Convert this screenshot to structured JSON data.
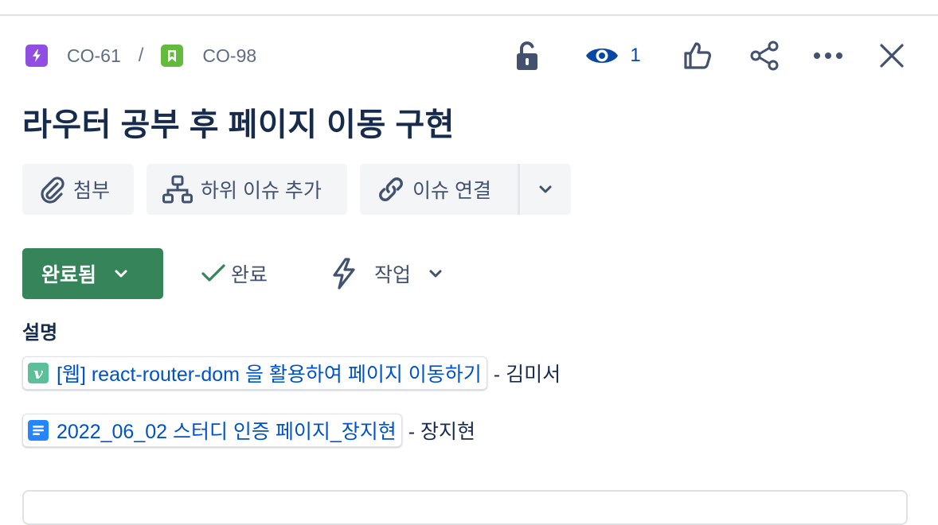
{
  "breadcrumb": {
    "parent_key": "CO-61",
    "separator": "/",
    "issue_key": "CO-98"
  },
  "header": {
    "watch_count": "1"
  },
  "issue": {
    "title": "라우터 공부 후 페이지 이동 구현"
  },
  "actions": {
    "attach": "첨부",
    "add_subtask": "하위 이슈 추가",
    "link_issue": "이슈 연결"
  },
  "status": {
    "status_label": "완료됨",
    "resolution": "완료",
    "work_type": "작업"
  },
  "description": {
    "heading": "설명",
    "links": [
      {
        "text": "[웹] react-router-dom 을 활용하여 페이지 이동하기",
        "author": "- 김미서",
        "icon_glyph": "v"
      },
      {
        "text": "2022_06_02 스터디 인증 페이지_장지현",
        "author": "- 장지현"
      }
    ]
  },
  "colors": {
    "status_green": "#36845a",
    "epic_purple": "#904ee2",
    "story_green": "#63ba3c",
    "link_blue": "#0052cc",
    "watch_blue": "#0747a6"
  }
}
